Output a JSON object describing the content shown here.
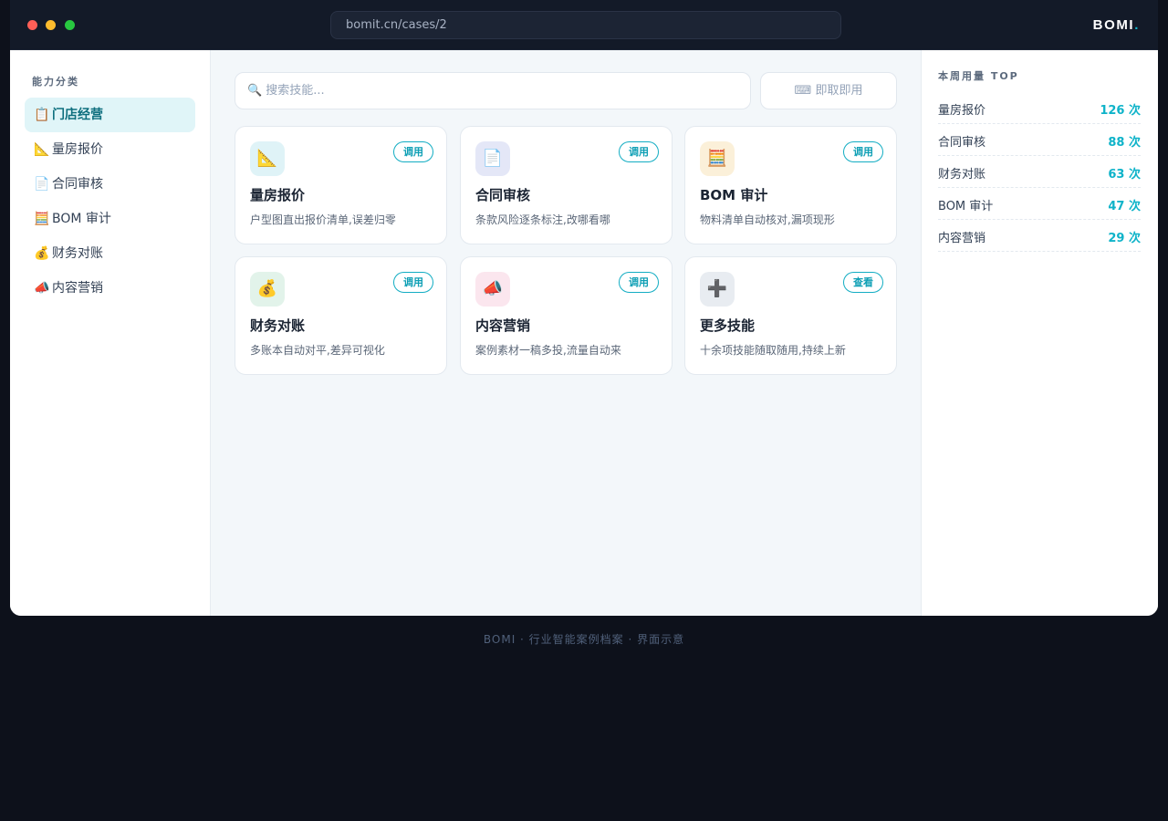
{
  "browser": {
    "url": "bomit.cn/cases/2",
    "brand": "BOMI",
    "brand_dot": "."
  },
  "sidebar": {
    "heading": "能力分类",
    "items": [
      {
        "icon": "📋",
        "icon_name": "clipboard-icon",
        "label": "门店经营",
        "active": true
      },
      {
        "icon": "📐",
        "icon_name": "triangle-ruler-icon",
        "label": "量房报价"
      },
      {
        "icon": "📄",
        "icon_name": "document-icon",
        "label": "合同审核"
      },
      {
        "icon": "🧮",
        "icon_name": "abacus-icon",
        "label": "BOM 审计"
      },
      {
        "icon": "💰",
        "icon_name": "money-bag-icon",
        "label": "财务对账"
      },
      {
        "icon": "📣",
        "icon_name": "megaphone-icon",
        "label": "内容营销"
      }
    ]
  },
  "main": {
    "search": {
      "icon": "🔍",
      "placeholder": "搜索技能..."
    },
    "ondemand_button": "⌨ 即取即用",
    "cards": [
      {
        "icon": "📐",
        "icon_name": "triangle-ruler-icon",
        "icon_bg": "#dff3f7",
        "title": "量房报价",
        "desc": "户型图直出报价清单,误差归零",
        "action": "调用"
      },
      {
        "icon": "📄",
        "icon_name": "document-icon",
        "icon_bg": "#e4e7f7",
        "title": "合同审核",
        "desc": "条款风险逐条标注,改哪看哪",
        "action": "调用"
      },
      {
        "icon": "🧮",
        "icon_name": "abacus-icon",
        "icon_bg": "#fbf0d9",
        "title": "BOM 审计",
        "desc": "物料清单自动核对,漏项现形",
        "action": "调用"
      },
      {
        "icon": "💰",
        "icon_name": "money-bag-icon",
        "icon_bg": "#e2f3ea",
        "title": "财务对账",
        "desc": "多账本自动对平,差异可视化",
        "action": "调用"
      },
      {
        "icon": "📣",
        "icon_name": "megaphone-icon",
        "icon_bg": "#fbe6ee",
        "title": "内容营销",
        "desc": "案例素材一稿多投,流量自动来",
        "action": "调用"
      },
      {
        "icon": "➕",
        "icon_name": "plus-icon",
        "icon_bg": "#e8ecf1",
        "title": "更多技能",
        "desc": "十余项技能随取随用,持续上新",
        "action": "查看"
      }
    ]
  },
  "usage_panel": {
    "heading": "本周用量 TOP",
    "rows": [
      {
        "name": "量房报价",
        "count": "126 次"
      },
      {
        "name": "合同审核",
        "count": "88 次"
      },
      {
        "name": "财务对账",
        "count": "63 次"
      },
      {
        "name": "BOM 审计",
        "count": "47 次"
      },
      {
        "name": "内容营销",
        "count": "29 次"
      }
    ]
  },
  "footer": {
    "text": "BOMI · 行业智能案例档案 · 界面示意"
  },
  "colors": {
    "accent": "#10b5cc",
    "active_bg": "#e0f5f8",
    "page_bg": "#0d111b"
  }
}
